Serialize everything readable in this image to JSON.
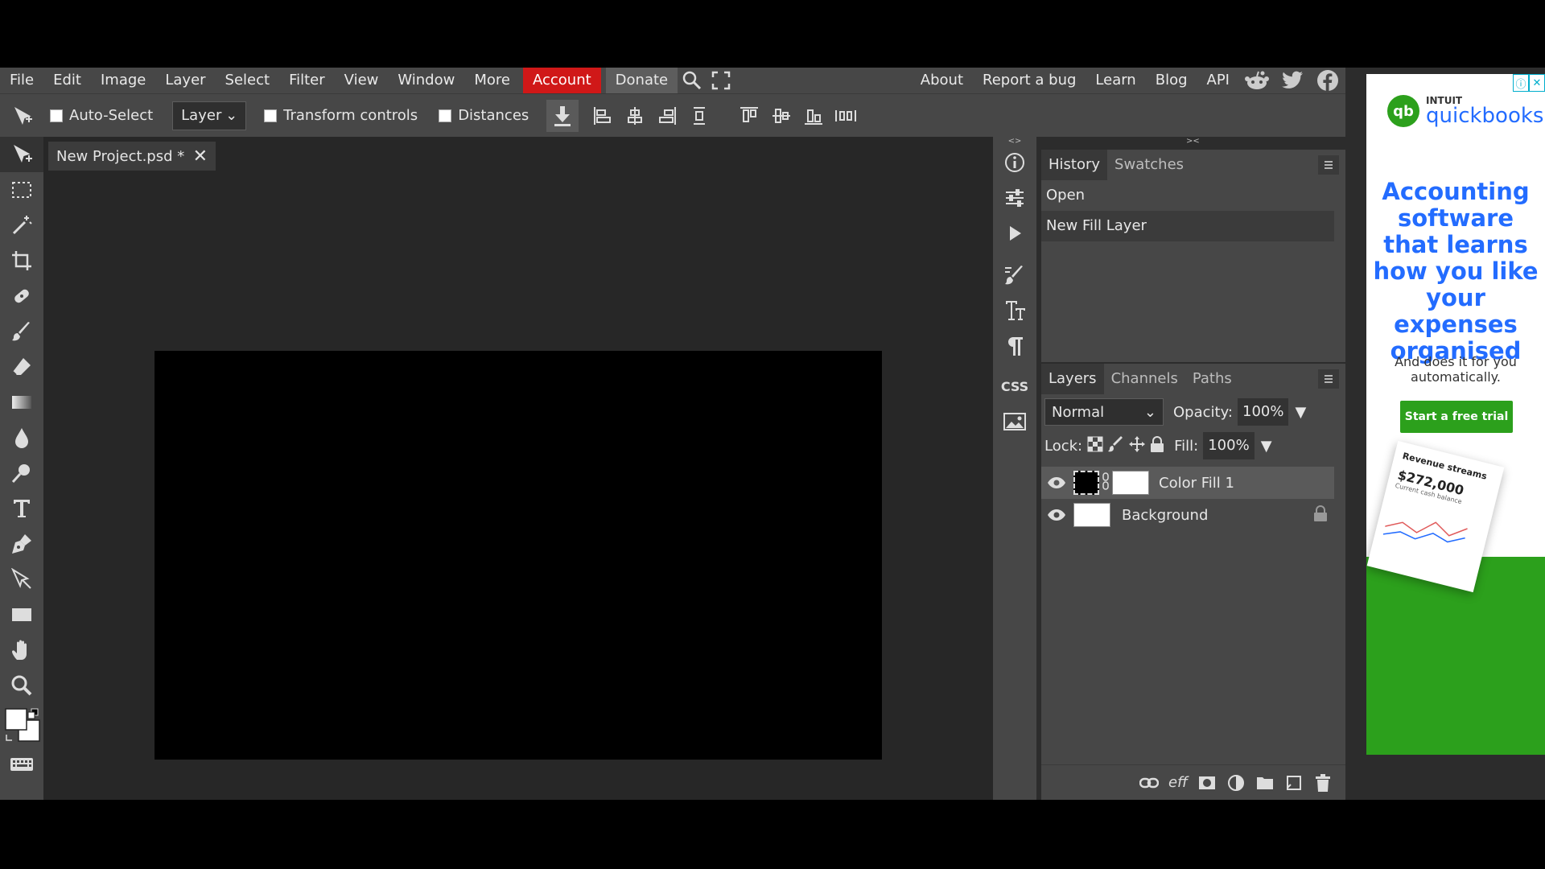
{
  "menu": {
    "items": [
      "File",
      "Edit",
      "Image",
      "Layer",
      "Select",
      "Filter",
      "View",
      "Window",
      "More"
    ],
    "account": "Account",
    "donate": "Donate",
    "right_links": [
      "About",
      "Report a bug",
      "Learn",
      "Blog",
      "API"
    ]
  },
  "options": {
    "auto_select": "Auto-Select",
    "layer_select": "Layer",
    "transform_controls": "Transform controls",
    "distances": "Distances"
  },
  "document": {
    "tab_title": "New Project.psd *",
    "canvas_color": "#000000"
  },
  "history": {
    "tabs": [
      "History",
      "Swatches"
    ],
    "items": [
      "Open",
      "New Fill Layer"
    ]
  },
  "layers": {
    "tabs": [
      "Layers",
      "Channels",
      "Paths"
    ],
    "blend_mode": "Normal",
    "opacity_label": "Opacity:",
    "opacity_value": "100%",
    "lock_label": "Lock:",
    "fill_label": "Fill:",
    "fill_value": "100%",
    "items": [
      {
        "name": "Color Fill 1",
        "selected": true
      },
      {
        "name": "Background",
        "selected": false,
        "locked": true
      }
    ]
  },
  "mini_panel": {
    "css_label": "CSS"
  },
  "ad": {
    "brand_small": "INTUIT",
    "brand_big": "quickbooks",
    "headline": "Accounting software that learns how you like your expenses organised",
    "subtext": "And does it for you automatically.",
    "cta": "Start a free trial",
    "card_title": "Revenue streams",
    "card_value": "$272,000",
    "card_caption": "Current cash balance"
  },
  "colors": {
    "accent_account": "#d01818",
    "panel_bg": "#474747",
    "workspace_bg": "#272727",
    "ad_green": "#2ca01c",
    "ad_blue": "#236cff"
  }
}
